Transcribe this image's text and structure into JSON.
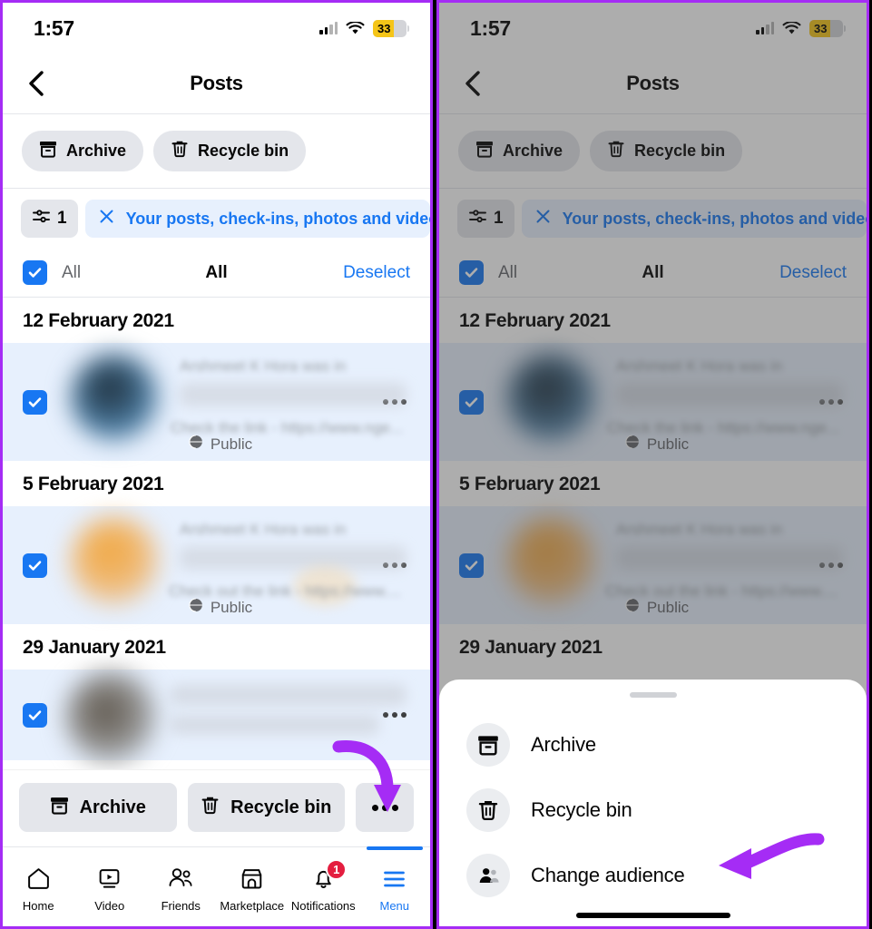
{
  "status_bar": {
    "time": "1:57",
    "battery_percent": "33",
    "cellular_icon": "cellular-signal-icon",
    "wifi_icon": "wifi-icon",
    "battery_icon": "battery-icon"
  },
  "nav": {
    "back_icon": "chevron-left-icon",
    "title": "Posts"
  },
  "chips": [
    {
      "label": "Archive",
      "icon": "archive-box-icon"
    },
    {
      "label": "Recycle bin",
      "icon": "trash-icon"
    }
  ],
  "filter_row": {
    "count": "1",
    "filter_icon": "sliders-filter-icon",
    "close_icon": "close-x-icon",
    "pill_label": "Your posts, check-ins, photos and videos"
  },
  "select_row": {
    "left_label": "All",
    "middle_label": "All",
    "right_label": "Deselect",
    "checked": true
  },
  "posts": [
    {
      "date": "12 February 2021",
      "author_line": "Arshmeet K Hora was in",
      "body_line": "Check the link - https://www.nge...",
      "privacy": "Public",
      "privacy_icon": "globe-icon",
      "more_icon": "more-horizontal-icon",
      "checked": true,
      "avatar_color": "#2f4858"
    },
    {
      "date": "5 February 2021",
      "author_line": "Arshmeet K Hora was in",
      "body_line": "Check out the link - https://www....",
      "privacy": "Public",
      "privacy_icon": "globe-icon",
      "more_icon": "more-horizontal-icon",
      "checked": true,
      "avatar_color": "#e8a33d"
    },
    {
      "date": "29 January 2021",
      "author_line": "",
      "body_line": "",
      "privacy": "",
      "privacy_icon": "globe-icon",
      "more_icon": "more-horizontal-icon",
      "checked": true,
      "avatar_color": "#6b6257"
    }
  ],
  "action_bar": {
    "archive_label": "Archive",
    "archive_icon": "archive-box-icon",
    "recycle_label": "Recycle bin",
    "recycle_icon": "trash-icon",
    "more_icon": "more-horizontal-icon"
  },
  "tab_bar": {
    "items": [
      {
        "label": "Home",
        "icon": "home-icon",
        "active": false,
        "badge": ""
      },
      {
        "label": "Video",
        "icon": "video-play-icon",
        "active": false,
        "badge": ""
      },
      {
        "label": "Friends",
        "icon": "friends-people-icon",
        "active": false,
        "badge": ""
      },
      {
        "label": "Marketplace",
        "icon": "marketplace-store-icon",
        "active": false,
        "badge": ""
      },
      {
        "label": "Notifications",
        "icon": "bell-icon",
        "active": false,
        "badge": "1"
      },
      {
        "label": "Menu",
        "icon": "hamburger-menu-icon",
        "active": true,
        "badge": ""
      }
    ]
  },
  "bottom_sheet": {
    "grabber_icon": "sheet-grabber-handle",
    "items": [
      {
        "label": "Archive",
        "icon": "archive-box-icon"
      },
      {
        "label": "Recycle bin",
        "icon": "trash-icon"
      },
      {
        "label": "Change audience",
        "icon": "audience-people-icon"
      }
    ]
  },
  "annotations": {
    "left_arrow_icon": "purple-curved-down-arrow",
    "right_arrow_icon": "purple-curved-left-arrow"
  },
  "colors": {
    "accent": "#1877F2",
    "border_purple": "#A52CF5",
    "chip_bg": "#E4E6EB",
    "selected_row_bg": "#E7F0FD",
    "badge_red": "#E41E3F",
    "battery_yellow": "#F5C518"
  }
}
